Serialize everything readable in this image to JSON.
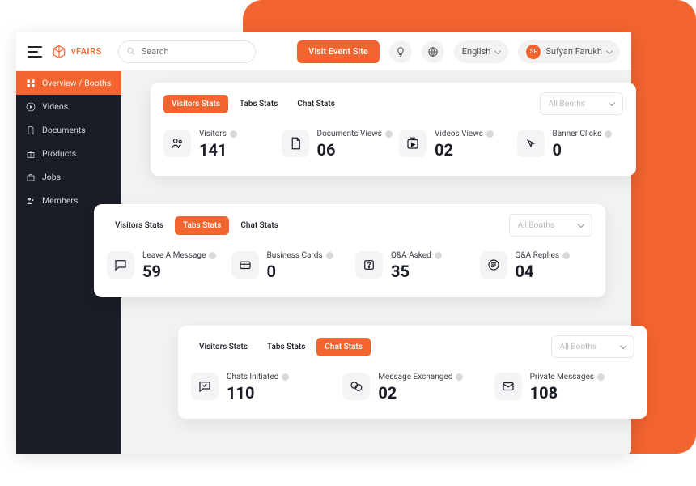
{
  "brand": "vFAIRS",
  "search": {
    "placeholder": "Search"
  },
  "header": {
    "visit_btn": "Visit Event Site",
    "language": "English",
    "user_name": "Sufyan Farukh",
    "user_initials": "SF"
  },
  "sidebar": {
    "items": [
      {
        "label": "Overview / Booths",
        "icon": "grid-icon",
        "active": true
      },
      {
        "label": "Videos",
        "icon": "play-icon",
        "active": false
      },
      {
        "label": "Documents",
        "icon": "document-icon",
        "active": false
      },
      {
        "label": "Products",
        "icon": "gift-icon",
        "active": false
      },
      {
        "label": "Jobs",
        "icon": "briefcase-icon",
        "active": false
      },
      {
        "label": "Members",
        "icon": "members-icon",
        "active": false
      }
    ]
  },
  "booth_filter": "All Booths",
  "tabs": {
    "visitors": "Visitors Stats",
    "tabs": "Tabs Stats",
    "chat": "Chat Stats"
  },
  "cards": {
    "a": {
      "active_tab": 0,
      "stats": [
        {
          "label": "Visitors",
          "value": "141"
        },
        {
          "label": "Documents Views",
          "value": "06"
        },
        {
          "label": "Videos Views",
          "value": "02"
        },
        {
          "label": "Banner Clicks",
          "value": "0"
        }
      ]
    },
    "b": {
      "active_tab": 1,
      "stats": [
        {
          "label": "Leave A Message",
          "value": "59"
        },
        {
          "label": "Business Cards",
          "value": "0"
        },
        {
          "label": "Q&A Asked",
          "value": "35"
        },
        {
          "label": "Q&A Replies",
          "value": "04"
        }
      ]
    },
    "c": {
      "active_tab": 2,
      "stats": [
        {
          "label": "Chats Initiated",
          "value": "110"
        },
        {
          "label": "Message Exchanged",
          "value": "02"
        },
        {
          "label": "Private Messages",
          "value": "108"
        }
      ]
    }
  }
}
